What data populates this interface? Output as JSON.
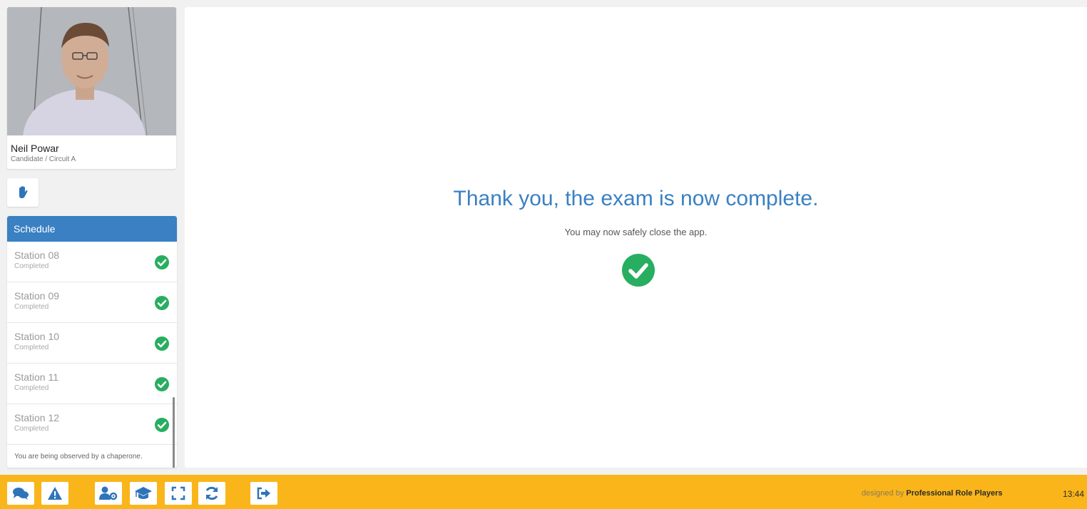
{
  "candidate": {
    "name": "Neil Powar",
    "role": "Candidate / Circuit A"
  },
  "schedule": {
    "header": "Schedule",
    "items": [
      {
        "name": "Station 08",
        "status": "Completed"
      },
      {
        "name": "Station 09",
        "status": "Completed"
      },
      {
        "name": "Station 10",
        "status": "Completed"
      },
      {
        "name": "Station 11",
        "status": "Completed"
      },
      {
        "name": "Station 12",
        "status": "Completed"
      }
    ],
    "note": "You are being observed by a chaperone."
  },
  "main": {
    "title": "Thank you, the exam is now complete.",
    "subtitle": "You may now safely close the app."
  },
  "footer": {
    "credit_prefix": "designed by",
    "credit_brand": "Professional Role Players",
    "time": "13:44",
    "tools": [
      "chat-icon",
      "warning-icon",
      "user-settings-icon",
      "graduation-cap-icon",
      "fullscreen-icon",
      "refresh-icon",
      "logout-icon"
    ]
  },
  "colors": {
    "accent_blue": "#3a80c3",
    "success_green": "#27ae60",
    "footer_yellow": "#f9b51a"
  }
}
